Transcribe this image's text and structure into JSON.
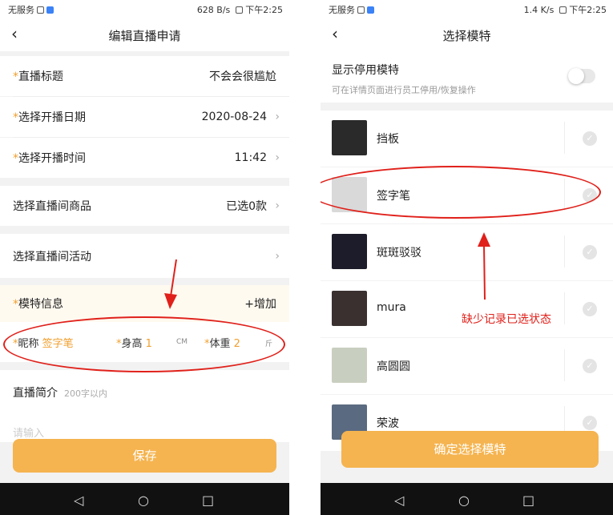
{
  "left": {
    "status": {
      "carrier": "无服务",
      "speed": "628 B/s",
      "time": "下午2:25"
    },
    "title": "编辑直播申请",
    "fields": {
      "title_label": "直播标题",
      "title_value": "不会会很尴尬",
      "date_label": "选择开播日期",
      "date_value": "2020-08-24",
      "time_label": "选择开播时间",
      "time_value": "11:42",
      "goods_label": "选择直播间商品",
      "goods_value": "已选0款",
      "activity_label": "选择直播间活动"
    },
    "model_info": {
      "label": "模特信息",
      "add": "+增加",
      "nickname_label": "昵称",
      "nickname_value": "签字笔",
      "height_label": "身高",
      "height_value": "1",
      "height_unit": "CM",
      "weight_label": "体重",
      "weight_value": "2",
      "weight_unit": "斤"
    },
    "intro": {
      "label": "直播简介",
      "hint": "200字以内",
      "placeholder": "请输入"
    },
    "save_label": "保存"
  },
  "right": {
    "status": {
      "carrier": "无服务",
      "speed": "1.4 K/s",
      "time": "下午2:25"
    },
    "title": "选择模特",
    "show_disabled": {
      "label": "显示停用模特",
      "hint": "可在详情页面进行员工停用/恢复操作",
      "on": false
    },
    "models": [
      {
        "name": "挡板",
        "avatar_color": "#2a2a2a"
      },
      {
        "name": "签字笔",
        "avatar_color": "#d9d9d9"
      },
      {
        "name": "斑斑驳驳",
        "avatar_color": "#1c1c2a"
      },
      {
        "name": "mura",
        "avatar_color": "#3a3030"
      },
      {
        "name": "高圆圆",
        "avatar_color": "#c9cfc0"
      },
      {
        "name": "荣波",
        "avatar_color": "#5a6a80"
      }
    ],
    "confirm_label": "确定选择模特",
    "annotation": "缺少记录已选状态"
  },
  "colors": {
    "accent": "#f5b450",
    "required_star": "#f0a030",
    "annotation": "#e0201a"
  }
}
